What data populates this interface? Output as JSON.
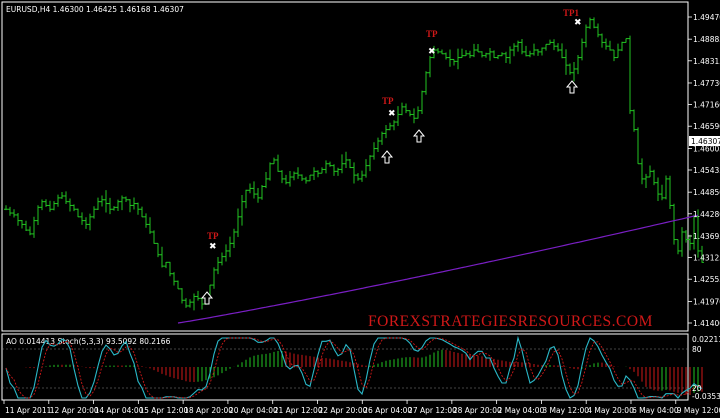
{
  "header": {
    "symbol": "EURUSD,H4",
    "ohlc": "1.46300 1.46425 1.46168 1.46307"
  },
  "price_axis": {
    "labels": [
      "1.49470",
      "1.48885",
      "1.48315",
      "1.47730",
      "1.47160",
      "1.46590",
      "1.46005",
      "1.45435",
      "1.44850",
      "1.44280",
      "1.43695",
      "1.43125",
      "1.42555",
      "1.41970",
      "1.41400"
    ],
    "current_price": "1.46307"
  },
  "time_axis": {
    "labels": [
      "11 Apr 2011",
      "12 Apr 20:00",
      "14 Apr 04:00",
      "15 Apr 12:00",
      "18 Apr 20:00",
      "20 Apr 04:00",
      "21 Apr 12:00",
      "22 Apr 20:00",
      "26 Apr 04:00",
      "27 Apr 12:00",
      "28 Apr 20:00",
      "2 May 04:00",
      "3 May 12:00",
      "4 May 20:00",
      "6 May 04:00",
      "9 May 12:00"
    ]
  },
  "indicator": {
    "header": "AO 0.014413  Stoch(5,3,3) 93.5092 80.2166",
    "axis_labels": [
      "0.022114",
      "80",
      "20",
      "-0.03531"
    ]
  },
  "annotations": {
    "tp_labels": [
      "TP",
      "TP",
      "TP",
      "TP1"
    ]
  },
  "watermark": "FOREXSTRATEGIESRESOURCES.COM",
  "colors": {
    "background": "#000000",
    "candle": "#22c322",
    "ma_line": "#7a1fc4",
    "ao_up": "#22c322",
    "ao_down": "#d01818",
    "stoch_main": "#2ab8c8",
    "stoch_signal": "#d01818",
    "tp_text": "#d01818",
    "watermark": "#d01818"
  },
  "chart_data": {
    "type": "line",
    "x": [
      0,
      4,
      8,
      12,
      16,
      20,
      24,
      28,
      32,
      36,
      40,
      44,
      48,
      52,
      56,
      60,
      64,
      68,
      72,
      76,
      80,
      84,
      88,
      92,
      96,
      100,
      104,
      108,
      112,
      116,
      120,
      124,
      128,
      132,
      136,
      140,
      144,
      148,
      152,
      156,
      160,
      164,
      168,
      172,
      176,
      180,
      184,
      188,
      192,
      196,
      200,
      204,
      208,
      212,
      216,
      220,
      224,
      228,
      232,
      236,
      240,
      244,
      248,
      252,
      256,
      260,
      264,
      268,
      272,
      276,
      280,
      284,
      288,
      292,
      296,
      300,
      304,
      308,
      312,
      316,
      320,
      324,
      328,
      332,
      336,
      340,
      344,
      348,
      352,
      356,
      360,
      364,
      368,
      372,
      376,
      380,
      384,
      388,
      392,
      396,
      400,
      404,
      408,
      412,
      416,
      420,
      424,
      428,
      432,
      436,
      440,
      444,
      448,
      452,
      456,
      460,
      464,
      468,
      472,
      476,
      480,
      484,
      488,
      492,
      496,
      500,
      504,
      508,
      512,
      516,
      520,
      524,
      528,
      532,
      536,
      540,
      544,
      548,
      552,
      556,
      560,
      564,
      568,
      572,
      576,
      580,
      584,
      588,
      592,
      596,
      600,
      604,
      608,
      612,
      616,
      620,
      624,
      628,
      632,
      636,
      640,
      644,
      648,
      652,
      656,
      660,
      664,
      668,
      672,
      676,
      680,
      684
    ],
    "series": [
      {
        "values": [
          1.444,
          1.443,
          1.4425,
          1.441,
          1.44,
          1.4385,
          1.4375,
          1.441,
          1.4445,
          1.446,
          1.445,
          1.444,
          1.4455,
          1.447,
          1.4475,
          1.446,
          1.445,
          1.444,
          1.442,
          1.441,
          1.44,
          1.442,
          1.444,
          1.446,
          1.4465,
          1.4455,
          1.444,
          1.4445,
          1.446,
          1.447,
          1.4465,
          1.445,
          1.4455,
          1.444,
          1.442,
          1.44,
          1.438,
          1.435,
          1.432,
          1.429,
          1.43,
          1.427,
          1.425,
          1.423,
          1.42,
          1.4185,
          1.4195,
          1.421,
          1.4205,
          1.419,
          1.4215,
          1.424,
          1.428,
          1.43,
          1.4315,
          1.433,
          1.435,
          1.438,
          1.442,
          1.446,
          1.449,
          1.4495,
          1.448,
          1.447,
          1.45,
          1.452,
          1.456,
          1.457,
          1.454,
          1.452,
          1.451,
          1.4525,
          1.4535,
          1.453,
          1.452,
          1.4515,
          1.453,
          1.454,
          1.4535,
          1.4545,
          1.456,
          1.4555,
          1.454,
          1.4545,
          1.456,
          1.457,
          1.455,
          1.453,
          1.452,
          1.453,
          1.4555,
          1.458,
          1.46,
          1.462,
          1.464,
          1.465,
          1.466,
          1.467,
          1.469,
          1.471,
          1.47,
          1.469,
          1.468,
          1.47,
          1.475,
          1.48,
          1.484,
          1.486,
          1.4855,
          1.485,
          1.484,
          1.4835,
          1.483,
          1.484,
          1.4845,
          1.485,
          1.4845,
          1.486,
          1.4855,
          1.4845,
          1.485,
          1.4855,
          1.484,
          1.4845,
          1.485,
          1.484,
          1.486,
          1.487,
          1.488,
          1.4855,
          1.4845,
          1.485,
          1.486,
          1.4855,
          1.4865,
          1.4875,
          1.488,
          1.487,
          1.486,
          1.484,
          1.482,
          1.48,
          1.481,
          1.484,
          1.488,
          1.492,
          1.494,
          1.492,
          1.49,
          1.488,
          1.487,
          1.486,
          1.484,
          1.486,
          1.488,
          1.489,
          1.47,
          1.465,
          1.456,
          1.452,
          1.4525,
          1.454,
          1.451,
          1.448,
          1.447,
          1.452,
          1.445,
          1.436,
          1.433,
          1.438,
          1.436,
          1.435,
          1.442,
          1.433,
          1.43
        ]
      }
    ],
    "ylim": [
      1.414,
      1.4947
    ]
  }
}
